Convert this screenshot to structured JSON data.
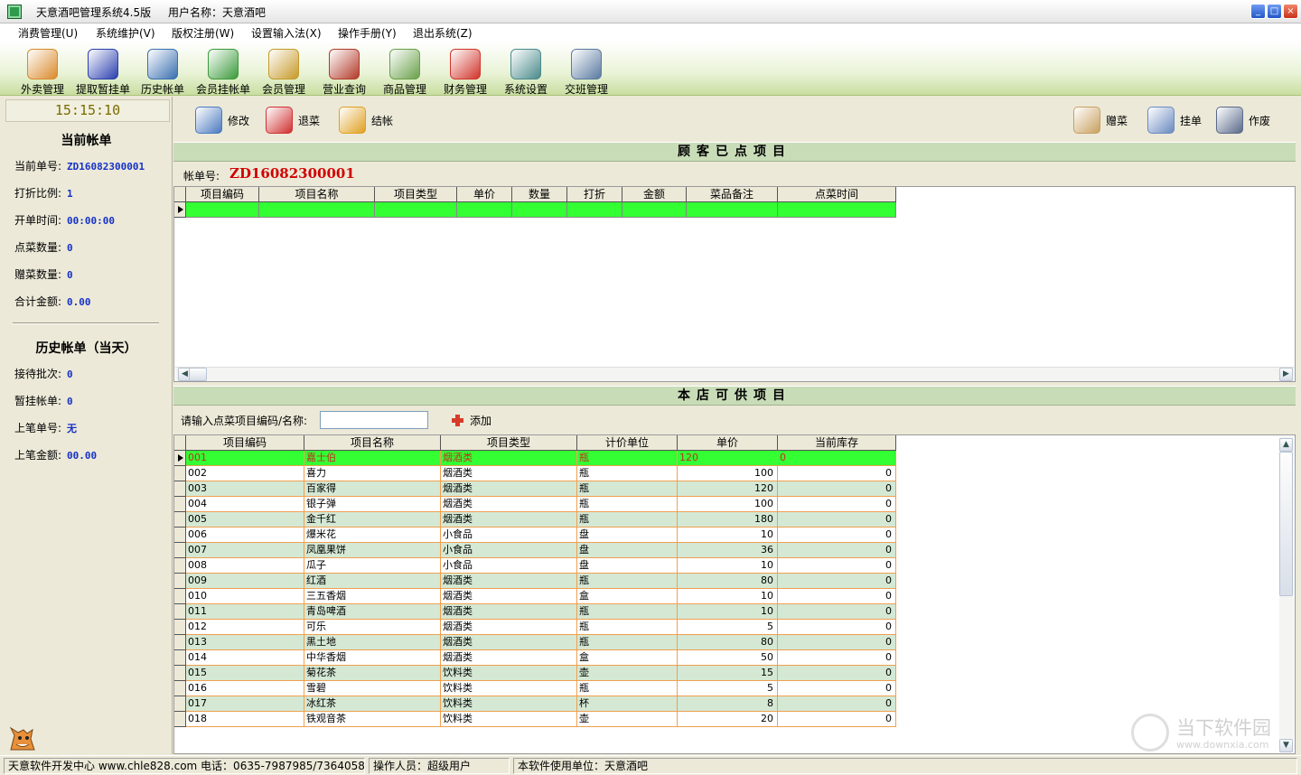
{
  "window": {
    "title": "天意酒吧管理系统4.5版",
    "user": "用户名称：天意酒吧",
    "minimize": "_",
    "maximize": "□",
    "close": "×"
  },
  "menu": [
    "消费管理(U)",
    "系统维护(V)",
    "版权注册(W)",
    "设置输入法(X)",
    "操作手册(Y)",
    "退出系统(Z)"
  ],
  "toolbar": [
    {
      "label": "外卖管理",
      "icon": "burger-icon",
      "color": "#d98a2a"
    },
    {
      "label": "提取暂挂单",
      "icon": "pen-icon",
      "color": "#2a3fae"
    },
    {
      "label": "历史帐单",
      "icon": "books-icon",
      "color": "#3a6fb0"
    },
    {
      "label": "会员挂帐单",
      "icon": "notepad-icon",
      "color": "#3b9a3b"
    },
    {
      "label": "会员管理",
      "icon": "members-icon",
      "color": "#c69a2a"
    },
    {
      "label": "营业查询",
      "icon": "inquiry-icon",
      "color": "#b23a2a"
    },
    {
      "label": "商品管理",
      "icon": "goods-icon",
      "color": "#6aa04a"
    },
    {
      "label": "财务管理",
      "icon": "finance-icon",
      "color": "#d0342a"
    },
    {
      "label": "系统设置",
      "icon": "settings-icon",
      "color": "#4a8a8a"
    },
    {
      "label": "交班管理",
      "icon": "handshake-icon",
      "color": "#5a7aa0"
    }
  ],
  "left": {
    "clock": "15:15:10",
    "current_title": "当前帐单",
    "current_rows": [
      {
        "label": "当前单号:",
        "value": "ZD16082300001"
      },
      {
        "label": "打折比例:",
        "value": "1"
      },
      {
        "label": "开单时间:",
        "value": "00:00:00"
      },
      {
        "label": "点菜数量:",
        "value": "0"
      },
      {
        "label": "赠菜数量:",
        "value": "0"
      },
      {
        "label": "合计金额:",
        "value": "0.00"
      }
    ],
    "history_title": "历史帐单（当天）",
    "history_rows": [
      {
        "label": "接待批次:",
        "value": "0"
      },
      {
        "label": "暂挂帐单:",
        "value": "0"
      },
      {
        "label": "上笔单号:",
        "value": "无"
      },
      {
        "label": "上笔金额:",
        "value": "00.00"
      }
    ]
  },
  "actions_left": [
    {
      "label": "修改",
      "icon": "edit-icon",
      "color": "#4a7ac0"
    },
    {
      "label": "退菜",
      "icon": "cross-icon",
      "color": "#d03030"
    },
    {
      "label": "结帐",
      "icon": "coins-icon",
      "color": "#e0a020"
    }
  ],
  "actions_right": [
    {
      "label": "赠菜",
      "icon": "clipboard-icon",
      "color": "#c8a060"
    },
    {
      "label": "挂单",
      "icon": "notepad-edit-icon",
      "color": "#6a8ac0"
    },
    {
      "label": "作废",
      "icon": "void-icon",
      "color": "#5a6a8a"
    }
  ],
  "ordered": {
    "title": "顾客已点项目",
    "bill_label": "帐单号:",
    "bill_no": "ZD16082300001",
    "columns": [
      "项目编码",
      "项目名称",
      "项目类型",
      "单价",
      "数量",
      "打折",
      "金额",
      "菜品备注",
      "点菜时间"
    ]
  },
  "available": {
    "title": "本店可供项目",
    "search_label": "请输入点菜项目编码/名称:",
    "search_value": "",
    "add_label": "添加",
    "columns": [
      "项目编码",
      "项目名称",
      "项目类型",
      "计价单位",
      "单价",
      "当前库存"
    ],
    "rows": [
      [
        "001",
        "嘉士伯",
        "烟酒类",
        "瓶",
        "120",
        "0"
      ],
      [
        "002",
        "喜力",
        "烟酒类",
        "瓶",
        "100",
        "0"
      ],
      [
        "003",
        "百家得",
        "烟酒类",
        "瓶",
        "120",
        "0"
      ],
      [
        "004",
        "银子弹",
        "烟酒类",
        "瓶",
        "100",
        "0"
      ],
      [
        "005",
        "金千红",
        "烟酒类",
        "瓶",
        "180",
        "0"
      ],
      [
        "006",
        "爆米花",
        "小食品",
        "盘",
        "10",
        "0"
      ],
      [
        "007",
        "凤凰果饼",
        "小食品",
        "盘",
        "36",
        "0"
      ],
      [
        "008",
        "瓜子",
        "小食品",
        "盘",
        "10",
        "0"
      ],
      [
        "009",
        "红酒",
        "烟酒类",
        "瓶",
        "80",
        "0"
      ],
      [
        "010",
        "三五香烟",
        "烟酒类",
        "盒",
        "10",
        "0"
      ],
      [
        "011",
        "青岛啤酒",
        "烟酒类",
        "瓶",
        "10",
        "0"
      ],
      [
        "012",
        "可乐",
        "烟酒类",
        "瓶",
        "5",
        "0"
      ],
      [
        "013",
        "黑土地",
        "烟酒类",
        "瓶",
        "80",
        "0"
      ],
      [
        "014",
        "中华香烟",
        "烟酒类",
        "盒",
        "50",
        "0"
      ],
      [
        "015",
        "菊花茶",
        "饮料类",
        "壶",
        "15",
        "0"
      ],
      [
        "016",
        "雪碧",
        "饮料类",
        "瓶",
        "5",
        "0"
      ],
      [
        "017",
        "冰红茶",
        "饮料类",
        "杯",
        "8",
        "0"
      ],
      [
        "018",
        "铁观音茶",
        "饮料类",
        "壶",
        "20",
        "0"
      ]
    ]
  },
  "status": {
    "developer": "天意软件开发中心 www.chle828.com 电话：0635-7987985/7364058",
    "operator": "操作人员：超级用户",
    "licensee": "本软件使用单位：天意酒吧"
  },
  "watermark": {
    "title": "当下软件园",
    "url": "www.downxia.com"
  },
  "colors": {
    "selected_row": "#33ff33",
    "alt_row": "#d4e8d4",
    "grid_line": "#f0a050",
    "section_header": "#c8dcb8",
    "bill_red": "#d00000",
    "value_blue": "#1531c8"
  }
}
